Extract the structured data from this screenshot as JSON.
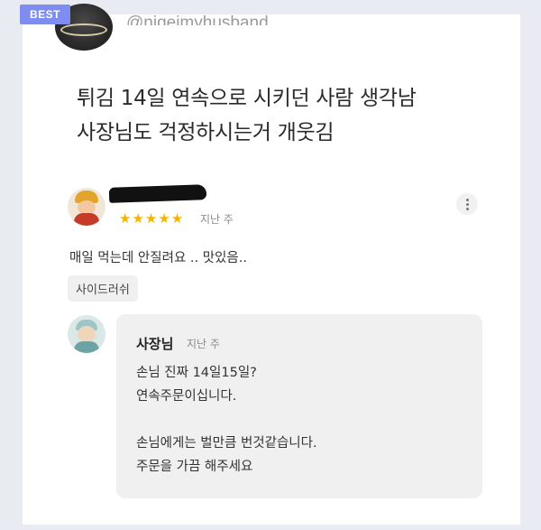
{
  "badge": {
    "label": "BEST"
  },
  "header": {
    "handle": "@nigeimyhusband"
  },
  "post": {
    "title_line1": "튀김 14일 연속으로 시키던 사람 생각남",
    "title_line2": "사장님도 걱정하시는거 개웃김"
  },
  "review": {
    "stars": "★★★★★",
    "rating": 5,
    "time": "지난 주",
    "text": "매일 먹는데 안질려요 .. 맛있음..",
    "tag": "사이드러쉬"
  },
  "owner_reply": {
    "name": "사장님",
    "time": "지난 주",
    "text": "손님 진짜 14일15일?\n연속주문이십니다.\n\n손님에게는 벌만큼 번것같습니다.\n주문을 가끔 해주세요"
  },
  "colors": {
    "badge_bg": "#7f8df0",
    "star": "#f5b400",
    "page_bg": "#e9ebf2",
    "bubble_bg": "#f0f0f0"
  }
}
